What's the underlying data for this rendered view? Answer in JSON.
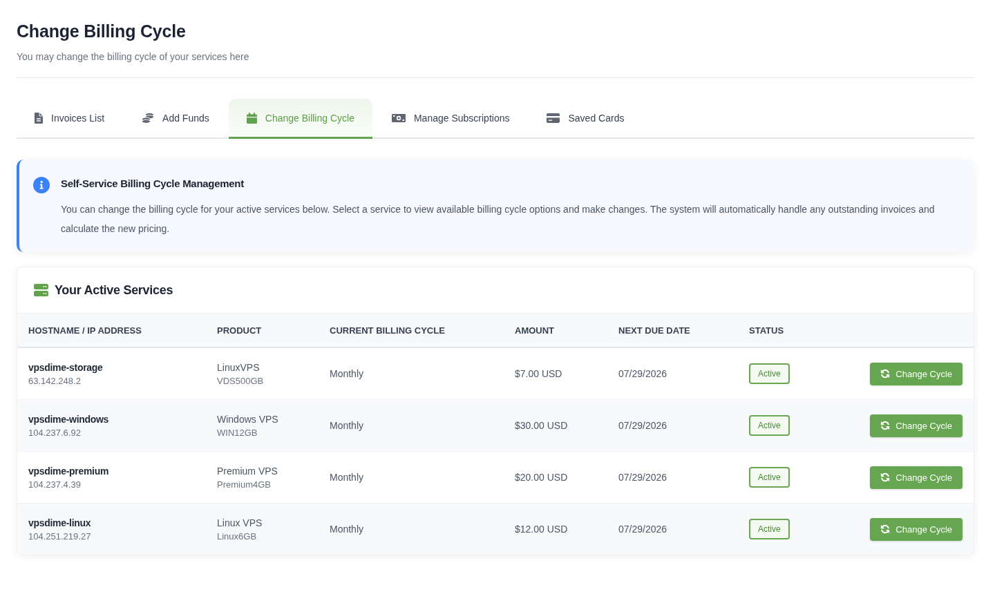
{
  "page": {
    "title": "Change Billing Cycle",
    "subtitle": "You may change the billing cycle of your services here"
  },
  "tabs": [
    {
      "label": "Invoices List",
      "selected": false
    },
    {
      "label": "Add Funds",
      "selected": false
    },
    {
      "label": "Change Billing Cycle",
      "selected": true
    },
    {
      "label": "Manage Subscriptions",
      "selected": false
    },
    {
      "label": "Saved Cards",
      "selected": false
    }
  ],
  "notice": {
    "title": "Self-Service Billing Cycle Management",
    "text": "You can change the billing cycle for your active services below. Select a service to view available billing cycle options and make changes. The system will automatically handle any outstanding invoices and calculate the new pricing."
  },
  "services": {
    "title": "Your Active Services",
    "columns": [
      "HOSTNAME / IP ADDRESS",
      "PRODUCT",
      "CURRENT BILLING CYCLE",
      "AMOUNT",
      "NEXT DUE DATE",
      "STATUS"
    ],
    "rows": [
      {
        "hostname": "vpsdime-storage",
        "ip": "63.142.248.2",
        "product": "LinuxVPS",
        "plan": "VDS500GB",
        "cycle": "Monthly",
        "amount": "$7.00 USD",
        "due": "07/29/2026",
        "status": "Active",
        "action": "Change Cycle"
      },
      {
        "hostname": "vpsdime-windows",
        "ip": "104.237.6.92",
        "product": "Windows VPS",
        "plan": "WIN12GB",
        "cycle": "Monthly",
        "amount": "$30.00 USD",
        "due": "07/29/2026",
        "status": "Active",
        "action": "Change Cycle"
      },
      {
        "hostname": "vpsdime-premium",
        "ip": "104.237.4.39",
        "product": "Premium VPS",
        "plan": "Premium4GB",
        "cycle": "Monthly",
        "amount": "$20.00 USD",
        "due": "07/29/2026",
        "status": "Active",
        "action": "Change Cycle"
      },
      {
        "hostname": "vpsdime-linux",
        "ip": "104.251.219.27",
        "product": "Linux VPS",
        "plan": "Linux6GB",
        "cycle": "Monthly",
        "amount": "$12.00 USD",
        "due": "07/29/2026",
        "status": "Active",
        "action": "Change Cycle"
      }
    ]
  }
}
